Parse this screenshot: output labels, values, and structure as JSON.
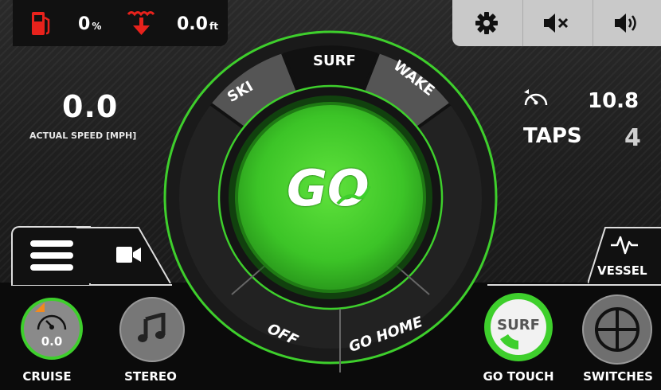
{
  "status": {
    "fuel_value": "0",
    "fuel_unit": "%",
    "depth_value": "0.0",
    "depth_unit": "ft"
  },
  "colors": {
    "accent_green": "#3ecf2c",
    "alert_red": "#e8221c",
    "orange": "#f28a1e"
  },
  "toolbar": {
    "icons": [
      "gear-icon",
      "mute-icon",
      "volume-icon"
    ]
  },
  "speed": {
    "value": "0.0",
    "label": "ACTUAL SPEED [MPH]"
  },
  "right_panel": {
    "speed_setting": "10.8",
    "taps_label": "TAPS",
    "taps_value": "4"
  },
  "dial": {
    "modes": [
      "SKI",
      "SURF",
      "WAKE"
    ],
    "selected_mode": "SURF",
    "go_label": "GO",
    "bottom_buttons": [
      "OFF",
      "GO HOME"
    ]
  },
  "tabs": {
    "menu_icon": "menu-icon",
    "camera_icon": "camera-icon",
    "vessel_label": "VESSEL"
  },
  "cruise": {
    "value": "0.0",
    "label": "CRUISE"
  },
  "stereo": {
    "label": "STEREO"
  },
  "go_touch": {
    "mode": "SURF",
    "label": "GO TOUCH"
  },
  "switches": {
    "label": "SWITCHES"
  }
}
